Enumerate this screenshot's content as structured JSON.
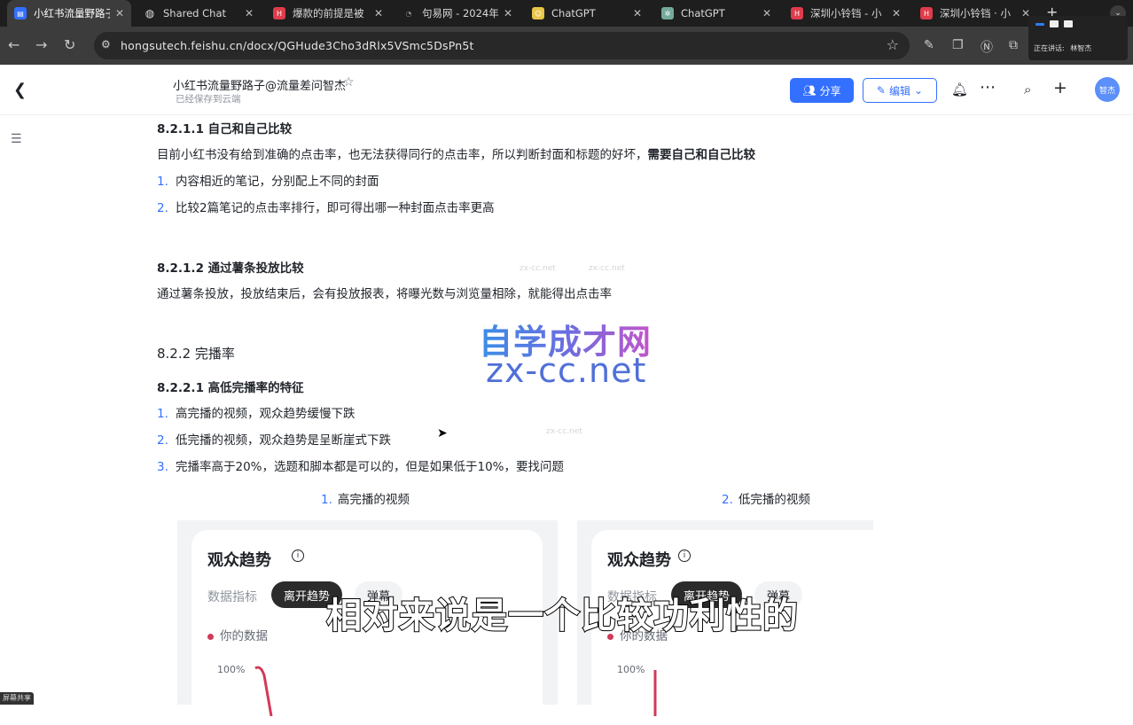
{
  "browser": {
    "tabs": [
      {
        "title": "小红书流量野路子",
        "icon": "feishu-doc-icon",
        "active": true
      },
      {
        "title": "Shared Chat",
        "icon": "globe-icon",
        "active": false
      },
      {
        "title": "爆款的前提是被",
        "icon": "hongsu-icon",
        "active": false
      },
      {
        "title": "句易网 - 2024年",
        "icon": "juyi-icon",
        "active": false
      },
      {
        "title": "ChatGPT",
        "icon": "chatgpt-yellow-icon",
        "active": false
      },
      {
        "title": "ChatGPT",
        "icon": "chatgpt-icon",
        "active": false
      },
      {
        "title": "深圳小铃铛 - 小",
        "icon": "hongsu-icon",
        "active": false
      },
      {
        "title": "深圳小铃铛 · 小",
        "icon": "hongsu-icon",
        "active": false
      }
    ],
    "url": "hongsutech.feishu.cn/docx/QGHude3Cho3dRlx5VSmc5DsPn5t",
    "presenter": {
      "speaking_label": "正在讲话:",
      "speaker": "林智杰"
    }
  },
  "header": {
    "title": "小红书流量野路子@流量差问智杰",
    "save_status": "已经保存到云端",
    "share_label": "分享",
    "edit_label": "编辑",
    "avatar_text": "智杰"
  },
  "doc": {
    "s1_heading": "8.2.1.1 自己和自己比较",
    "s1_para_plain": "目前小红书没有给到准确的点击率，也无法获得同行的点击率，所以判断封面和标题的好坏，",
    "s1_para_bold": "需要自己和自己比较",
    "s1_items": [
      {
        "num": "1.",
        "text": "内容相近的笔记，分别配上不同的封面"
      },
      {
        "num": "2.",
        "text": "比较2篇笔记的点击率排行，即可得出哪一种封面点击率更高"
      }
    ],
    "s2_heading": "8.2.1.2 通过薯条投放比较",
    "s2_para": "通过薯条投放，投放结束后，会有投放报表，将曝光数与浏览量相除，就能得出点击率",
    "s3_heading": "8.2.2 完播率",
    "s4_heading": "8.2.2.1 高低完播率的特征",
    "s4_items": [
      {
        "num": "1.",
        "text": "高完播的视频，观众趋势缓慢下跌"
      },
      {
        "num": "2.",
        "text": "低完播的视频，观众趋势是呈断崖式下跌"
      },
      {
        "num": "3.",
        "text": "完播率高于20%，选题和脚本都是可以的，但是如果低于10%，要找问题"
      }
    ],
    "image_cols": [
      {
        "num": "1.",
        "label": "高完播的视频"
      },
      {
        "num": "2.",
        "label": "低完播的视频"
      }
    ],
    "card": {
      "title": "观众趋势",
      "metric_label": "数据指标",
      "pill_active": "离开趋势",
      "pill_other": "弹幕",
      "legend": "你的数据",
      "y_top": "100%"
    }
  },
  "watermark": {
    "line1": "自学成才网",
    "line2": "zx-cc.net",
    "ring": "zx-cc.net"
  },
  "subtitle": "相对来说是一个比较功利性的",
  "screenshare_label": "屏幕共享",
  "colors": {
    "accent": "#3370ff",
    "chart_line": "#d13a5a",
    "chrome_dark": "#1e1e1e"
  }
}
